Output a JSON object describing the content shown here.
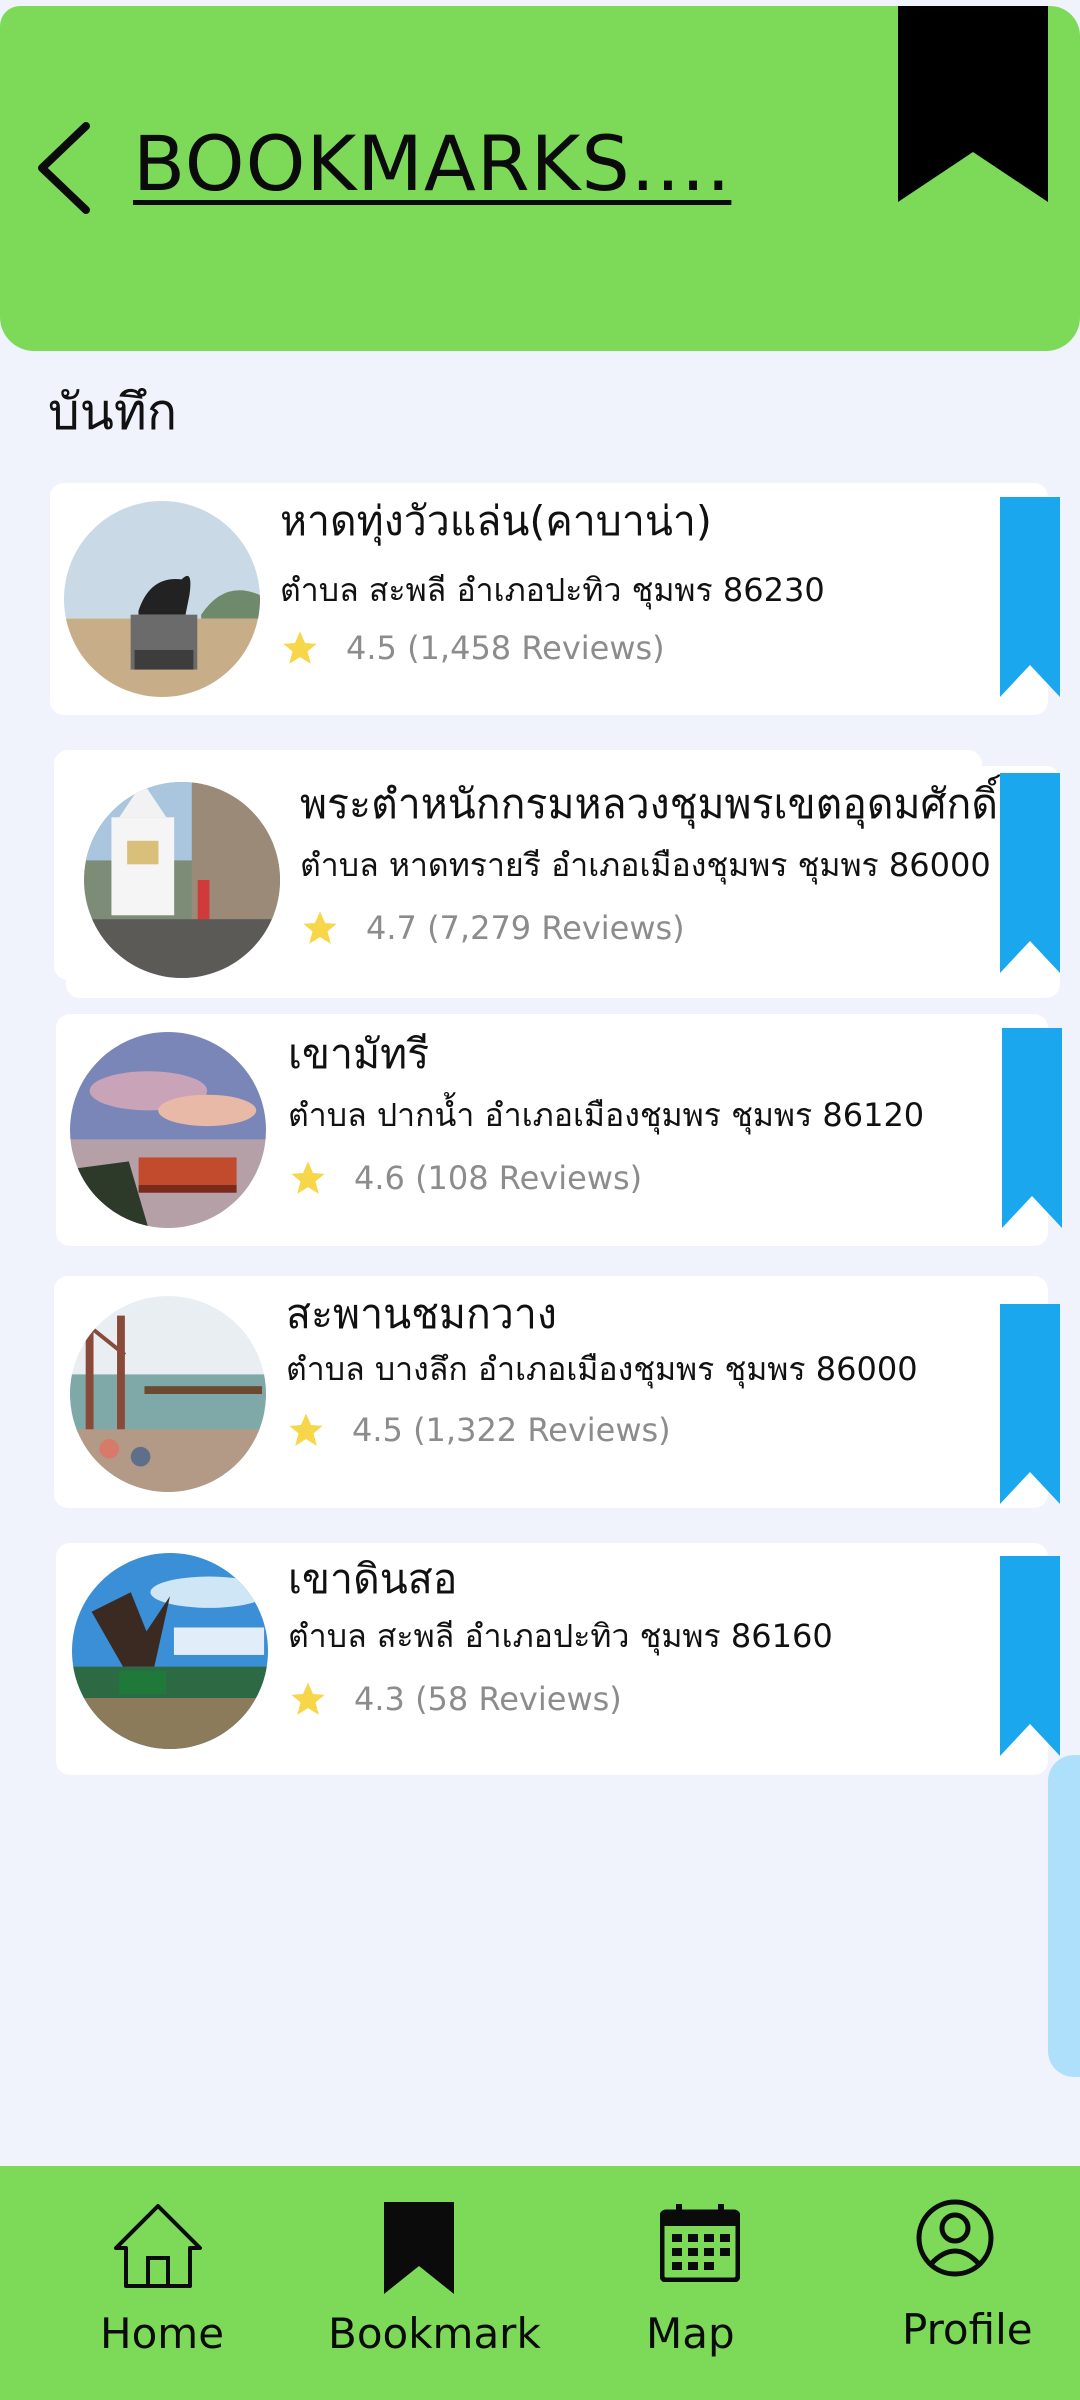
{
  "header": {
    "title": "BOOKMARKS...."
  },
  "section": {
    "title": "บันทึก"
  },
  "places": [
    {
      "name": "หาดทุ่งวัวแล่น(คาบาน่า)",
      "address": "ตำบล สะพลี อำเภอปะทิว ชุมพร 86230",
      "rating": "4.5 (1,458  Reviews)"
    },
    {
      "name": "พระตำหนักกรมหลวงชุมพรเขตอุดมศักดิ์",
      "address": "ตำบล หาดทรายรี อำเภอเมืองชุมพร ชุมพร 86000",
      "rating": "4.7 (7,279 Reviews)"
    },
    {
      "name": "เขามัทรี",
      "address": "ตำบล ปากน้ำ อำเภอเมืองชุมพร ชุมพร 86120",
      "rating": "4.6 (108 Reviews)"
    },
    {
      "name": "สะพานชมกวาง",
      "address": "ตำบล บางลึก อำเภอเมืองชุมพร ชุมพร 86000",
      "rating": "4.5 (1,322 Reviews)"
    },
    {
      "name": "เขาดินสอ",
      "address": "ตำบล สะพลี อำเภอปะทิว ชุมพร 86160",
      "rating": "4.3 (58 Reviews)"
    }
  ],
  "nav": [
    {
      "label": "Home",
      "icon": "home-icon"
    },
    {
      "label": "Bookmark",
      "icon": "bookmark-icon"
    },
    {
      "label": "Map",
      "icon": "calendar-icon"
    },
    {
      "label": "Profile",
      "icon": "profile-icon"
    }
  ],
  "colors": {
    "accent_green": "#7dda58",
    "ribbon_blue": "#1aa7ee",
    "star_yellow": "#f7d749",
    "background": "#f1f3fc"
  }
}
